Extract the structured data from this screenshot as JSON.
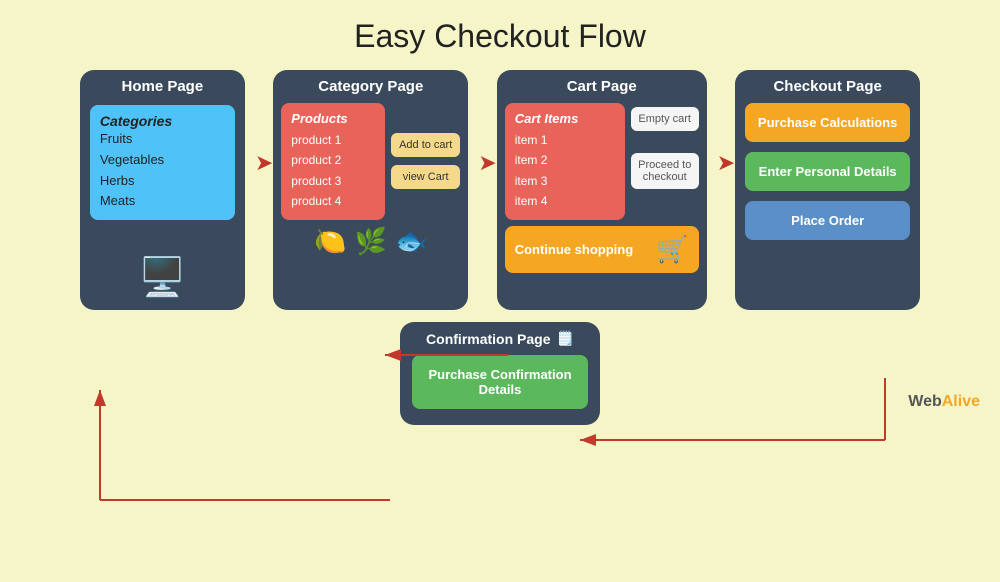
{
  "title": "Easy Checkout Flow",
  "pages": {
    "home": {
      "title": "Home Page",
      "categories_title": "Categories",
      "categories": [
        "Fruits",
        "Vegetables",
        "Herbs",
        "Meats"
      ],
      "icon": "🖥️"
    },
    "category": {
      "title": "Category Page",
      "products_title": "Products",
      "products": [
        "product 1",
        "product 2",
        "product 3",
        "product 4"
      ],
      "add_to_cart": "Add to cart",
      "view_cart": "view Cart",
      "emojis": [
        "🍋",
        "🌿",
        "🐟"
      ]
    },
    "cart": {
      "title": "Cart Page",
      "items_title": "Cart Items",
      "items": [
        "item 1",
        "item 2",
        "item 3",
        "item 4"
      ],
      "empty_cart": "Empty cart",
      "proceed": "Proceed to checkout",
      "continue_shopping": "Continue shopping",
      "cart_icon": "🛒"
    },
    "checkout": {
      "title": "Checkout Page",
      "purchase_calculations": "Purchase Calculations",
      "personal_details": "Enter Personal Details",
      "place_order": "Place Order"
    },
    "confirmation": {
      "title": "Confirmation Page",
      "icon": "🗒️",
      "details": "Purchase Confirmation Details"
    }
  },
  "brand": {
    "web": "Web",
    "alive": "Alive"
  }
}
